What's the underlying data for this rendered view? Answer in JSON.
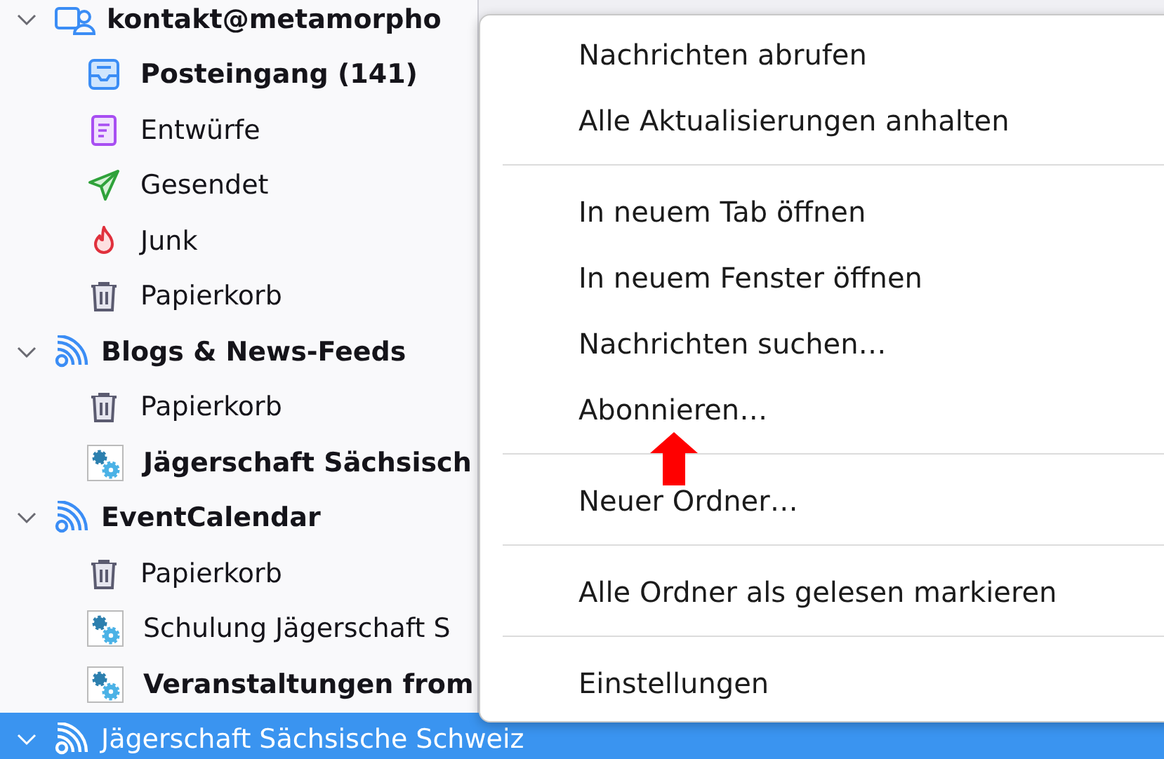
{
  "folder_tree": [
    {
      "label": "kontakt@metamorpho",
      "kind": "account",
      "unread": true,
      "selected": false,
      "expanded": true,
      "children": [
        {
          "label": "Posteingang (141)",
          "kind": "inbox",
          "unread": true,
          "selected": false
        },
        {
          "label": "Entwürfe",
          "kind": "drafts",
          "unread": false,
          "selected": false
        },
        {
          "label": "Gesendet",
          "kind": "sent",
          "unread": false,
          "selected": false
        },
        {
          "label": "Junk",
          "kind": "junk",
          "unread": false,
          "selected": false
        },
        {
          "label": "Papierkorb",
          "kind": "trash",
          "unread": false,
          "selected": false
        }
      ]
    },
    {
      "label": "Blogs & News-Feeds",
      "kind": "feed",
      "unread": true,
      "selected": false,
      "expanded": true,
      "children": [
        {
          "label": "Papierkorb",
          "kind": "trash",
          "unread": false,
          "selected": false
        },
        {
          "label": "Jägerschaft Sächsisch",
          "kind": "gears",
          "unread": true,
          "selected": false
        }
      ]
    },
    {
      "label": "EventCalendar",
      "kind": "feed",
      "unread": true,
      "selected": false,
      "expanded": true,
      "children": [
        {
          "label": "Papierkorb",
          "kind": "trash",
          "unread": false,
          "selected": false
        },
        {
          "label": "Schulung Jägerschaft S",
          "kind": "gears",
          "unread": false,
          "selected": false
        },
        {
          "label": "Veranstaltungen from",
          "kind": "gears",
          "unread": true,
          "selected": false
        }
      ]
    },
    {
      "label": "Jägerschaft Sächsische Schweiz",
      "kind": "feed",
      "unread": false,
      "selected": true,
      "expanded": true
    }
  ],
  "context_menu": [
    {
      "kind": "item",
      "label": "Nachrichten abrufen"
    },
    {
      "kind": "item",
      "label": "Alle Aktualisierungen anhalten"
    },
    {
      "kind": "separator"
    },
    {
      "kind": "item",
      "label": "In neuem Tab öffnen"
    },
    {
      "kind": "item",
      "label": "In neuem Fenster öffnen"
    },
    {
      "kind": "item",
      "label": "Nachrichten suchen…"
    },
    {
      "kind": "item",
      "label": "Abonnieren…"
    },
    {
      "kind": "separator"
    },
    {
      "kind": "item",
      "label": "Neuer Ordner…"
    },
    {
      "kind": "separator"
    },
    {
      "kind": "item",
      "label": "Alle Ordner als gelesen markieren"
    },
    {
      "kind": "separator"
    },
    {
      "kind": "item",
      "label": "Einstellungen"
    }
  ],
  "annotation_arrow": true
}
